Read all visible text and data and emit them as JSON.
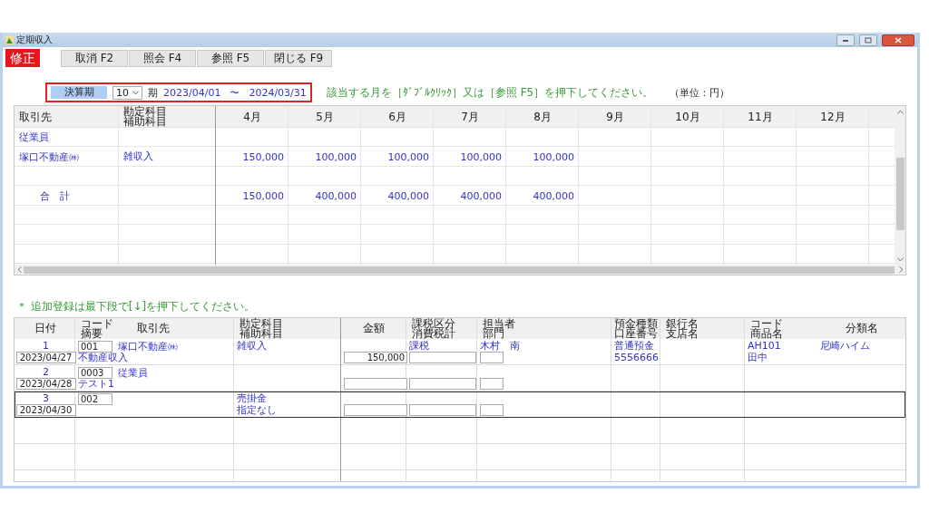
{
  "window": {
    "title": "定期収入"
  },
  "mode_badge": "修正",
  "toolbar": [
    "取消 F2",
    "照会 F4",
    "参照 F5",
    "閉じる F9"
  ],
  "period": {
    "label": "決算期",
    "term": "10",
    "term_suffix": "期",
    "from": "2023/04/01",
    "separator": "〜",
    "to": "2024/03/31"
  },
  "hint": "該当する月を［ﾀﾞﾌﾞﾙｸﾘｯｸ］又は［参照 F5］を押下してください。",
  "unit": "（単位：円）",
  "summary_table": {
    "columns": [
      "取引先",
      "勘定科目補助科目",
      "4月",
      "5月",
      "6月",
      "7月",
      "8月",
      "9月",
      "10月",
      "11月",
      "12月"
    ],
    "rows": [
      {
        "kind": "entry",
        "partner": "従業員"
      },
      {
        "kind": "entry",
        "partner": "塚口不動産㈱",
        "account": "雑収入",
        "values": [
          "150,000",
          "100,000",
          "100,000",
          "100,000",
          "100,000"
        ]
      },
      {
        "kind": "blank"
      },
      {
        "kind": "total",
        "partner": "合　計",
        "values": [
          "150,000",
          "400,000",
          "400,000",
          "400,000",
          "400,000"
        ]
      }
    ]
  },
  "note": "＊ 追加登録は最下段で[↓]を押下してください。",
  "entry_table": {
    "columns": [
      "日付",
      "コード摘要",
      "取引先",
      "勘定科目補助科目",
      "金額",
      "課税区分消費税計",
      "担当者部門",
      "預金種類口座番号",
      "銀行名支店名",
      "コード商品名",
      "分類名"
    ],
    "entries": [
      {
        "number": "1",
        "date": "2023/04/27",
        "code": "001",
        "partner": "塚口不動産㈱",
        "summary": "不動産収入",
        "account": "雑収入",
        "amount": "150,000",
        "tax_class": "課税",
        "staff": "木村　南",
        "deposit_type": "普通預金",
        "account_number": "5556666",
        "product_code": "AH101",
        "product_name": "田中",
        "category": "尼崎ハイム",
        "selected": false
      },
      {
        "number": "2",
        "date": "2023/04/28",
        "code": "0003",
        "partner": "従業員",
        "summary": "テスト1",
        "selected": false
      },
      {
        "number": "3",
        "date": "2023/04/30",
        "code": "002",
        "account": "売掛金",
        "sub_account": "指定なし",
        "selected": true
      }
    ]
  }
}
